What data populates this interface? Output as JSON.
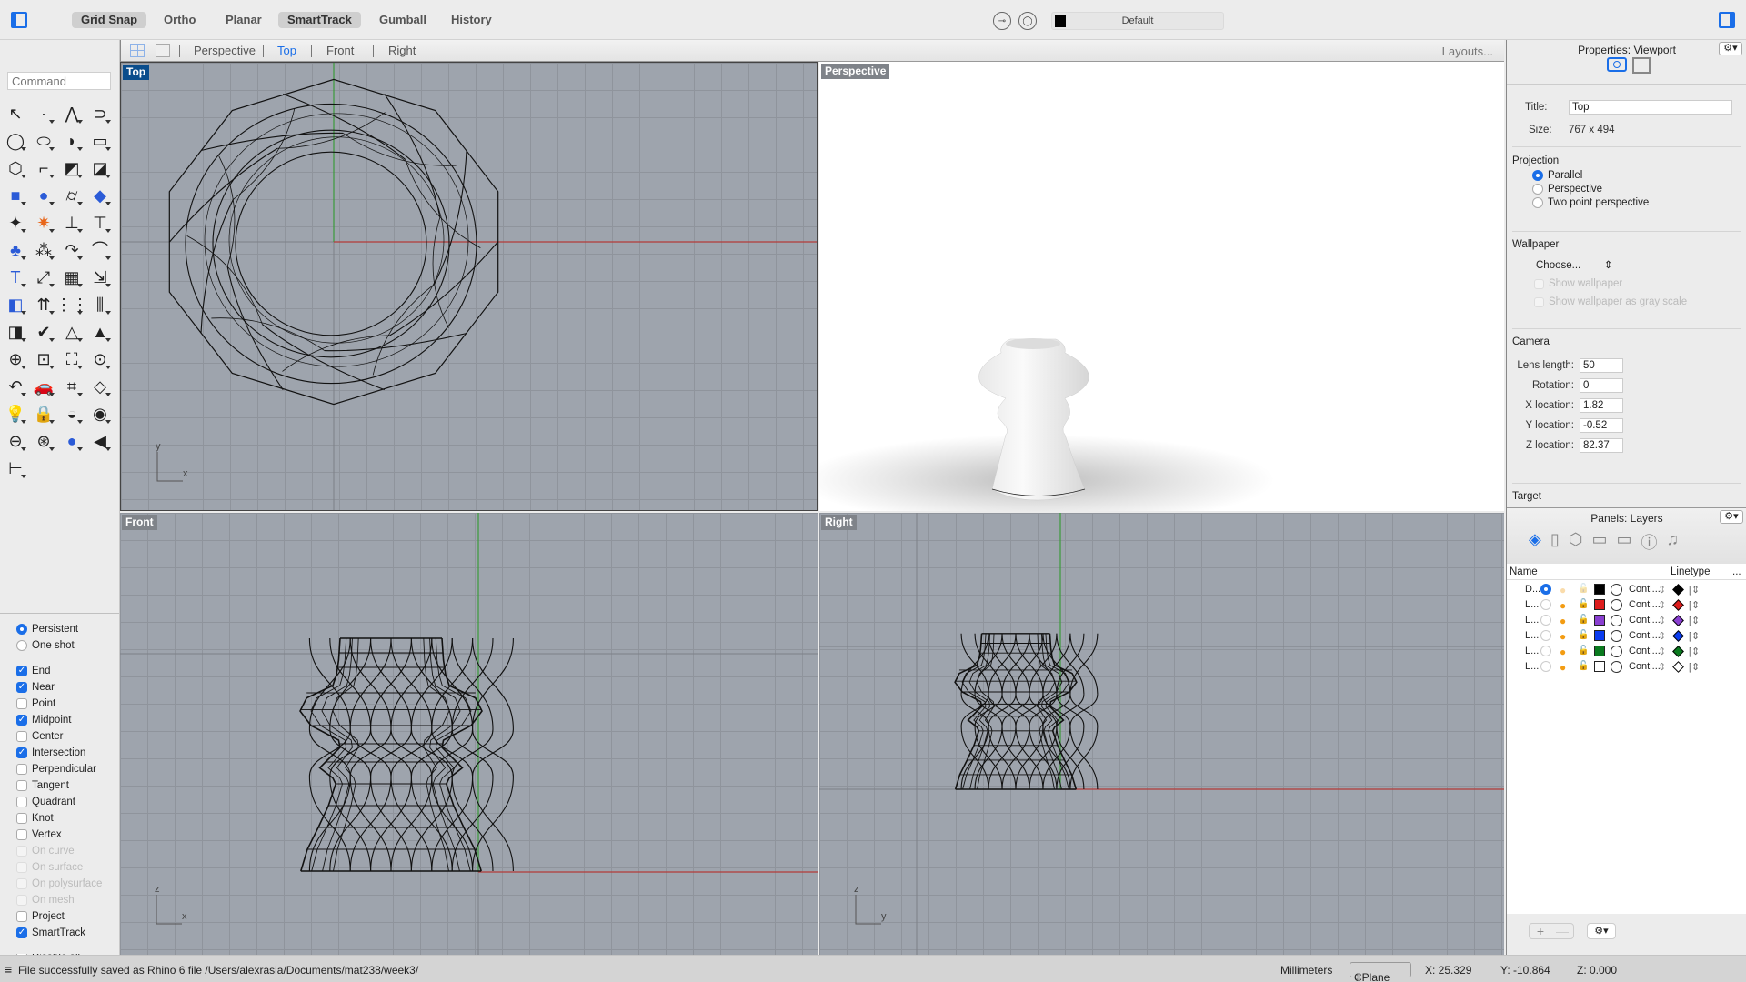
{
  "toolbar": {
    "modes": [
      {
        "label": "Grid Snap",
        "active": true
      },
      {
        "label": "Ortho",
        "active": false
      },
      {
        "label": "Planar",
        "active": false
      },
      {
        "label": "SmartTrack",
        "active": true
      },
      {
        "label": "Gumball",
        "active": false
      },
      {
        "label": "History",
        "active": false
      }
    ],
    "current_layer": "Default",
    "current_layer_color": "#000000"
  },
  "viewport_tabs": {
    "tabs": [
      "Perspective",
      "Top",
      "Front",
      "Right"
    ],
    "active": "Top",
    "layouts_label": "Layouts..."
  },
  "command": {
    "placeholder": "Command"
  },
  "tools": [
    {
      "icon": "select-arrow-icon",
      "glyph": "↖"
    },
    {
      "icon": "point-icon",
      "glyph": "·"
    },
    {
      "icon": "polyline-icon",
      "glyph": "⋀"
    },
    {
      "icon": "curve-icon",
      "glyph": "⊃"
    },
    {
      "icon": "circle-icon",
      "glyph": "◯"
    },
    {
      "icon": "ellipse-icon",
      "glyph": "⬭"
    },
    {
      "icon": "arc-icon",
      "glyph": "◗"
    },
    {
      "icon": "rectangle-icon",
      "glyph": "▭"
    },
    {
      "icon": "polygon-icon",
      "glyph": "⬡"
    },
    {
      "icon": "fillet-curve-icon",
      "glyph": "⌐"
    },
    {
      "icon": "surface-corner-icon",
      "glyph": "◩"
    },
    {
      "icon": "extrude-surface-icon",
      "glyph": "◪"
    },
    {
      "icon": "box-icon",
      "glyph": "■"
    },
    {
      "icon": "boolean-union-icon",
      "glyph": "●"
    },
    {
      "icon": "cylinder-icon",
      "glyph": "⌭"
    },
    {
      "icon": "surface-patch-icon",
      "glyph": "◆"
    },
    {
      "icon": "puzzle-join-icon",
      "glyph": "✦"
    },
    {
      "icon": "explode-icon",
      "glyph": "✷"
    },
    {
      "icon": "trim-icon",
      "glyph": "⊥"
    },
    {
      "icon": "split-icon",
      "glyph": "⊤"
    },
    {
      "icon": "boolean-difference-icon",
      "glyph": "♣"
    },
    {
      "icon": "points-group-icon",
      "glyph": "⁂"
    },
    {
      "icon": "rebuild-curve-icon",
      "glyph": "↷"
    },
    {
      "icon": "offset-curve-icon",
      "glyph": "⌒"
    },
    {
      "icon": "text-icon",
      "glyph": "T"
    },
    {
      "icon": "move-icon",
      "glyph": "⤢"
    },
    {
      "icon": "array-icon",
      "glyph": "▦"
    },
    {
      "icon": "scale-icon",
      "glyph": "⇲"
    },
    {
      "icon": "solid-edit-icon",
      "glyph": "◧"
    },
    {
      "icon": "normals-icon",
      "glyph": "⇈"
    },
    {
      "icon": "grid-array-icon",
      "glyph": "⋮⋮"
    },
    {
      "icon": "gumball-align-icon",
      "glyph": "⫼"
    },
    {
      "icon": "analyze-icon",
      "glyph": "◨"
    },
    {
      "icon": "check-icon",
      "glyph": "✔"
    },
    {
      "icon": "shapes-icon",
      "glyph": "△"
    },
    {
      "icon": "pyramid-icon",
      "glyph": "▲"
    },
    {
      "icon": "zoom-icon",
      "glyph": "⊕"
    },
    {
      "icon": "zoom-window-icon",
      "glyph": "⊡"
    },
    {
      "icon": "zoom-extents-icon",
      "glyph": "⛶"
    },
    {
      "icon": "zoom-selected-icon",
      "glyph": "⊙"
    },
    {
      "icon": "undo-view-icon",
      "glyph": "↶"
    },
    {
      "icon": "car-icon",
      "glyph": "🚗"
    },
    {
      "icon": "cplane-icon",
      "glyph": "⌗"
    },
    {
      "icon": "named-shapes-icon",
      "glyph": "◇"
    },
    {
      "icon": "light-bulb-icon",
      "glyph": "💡"
    },
    {
      "icon": "lock-icon",
      "glyph": "🔒"
    },
    {
      "icon": "materials-icon",
      "glyph": "◒"
    },
    {
      "icon": "color-wheel-icon",
      "glyph": "◉"
    },
    {
      "icon": "wireframe-sphere-icon",
      "glyph": "⊖"
    },
    {
      "icon": "grid-sphere-icon",
      "glyph": "⊛"
    },
    {
      "icon": "rendered-sphere-icon",
      "glyph": "●"
    },
    {
      "icon": "render-cone-icon",
      "glyph": "◀"
    },
    {
      "icon": "dimension-icon",
      "glyph": "⊢"
    }
  ],
  "osnap": {
    "mode": [
      {
        "label": "Persistent",
        "selected": true
      },
      {
        "label": "One shot",
        "selected": false
      }
    ],
    "items": [
      {
        "label": "End",
        "checked": true,
        "enabled": true
      },
      {
        "label": "Near",
        "checked": true,
        "enabled": true
      },
      {
        "label": "Point",
        "checked": false,
        "enabled": true
      },
      {
        "label": "Midpoint",
        "checked": true,
        "enabled": true
      },
      {
        "label": "Center",
        "checked": false,
        "enabled": true
      },
      {
        "label": "Intersection",
        "checked": true,
        "enabled": true
      },
      {
        "label": "Perpendicular",
        "checked": false,
        "enabled": true
      },
      {
        "label": "Tangent",
        "checked": false,
        "enabled": true
      },
      {
        "label": "Quadrant",
        "checked": false,
        "enabled": true
      },
      {
        "label": "Knot",
        "checked": false,
        "enabled": true
      },
      {
        "label": "Vertex",
        "checked": false,
        "enabled": true
      },
      {
        "label": "On curve",
        "checked": false,
        "enabled": false
      },
      {
        "label": "On surface",
        "checked": false,
        "enabled": false
      },
      {
        "label": "On polysurface",
        "checked": false,
        "enabled": false
      },
      {
        "label": "On mesh",
        "checked": false,
        "enabled": false
      },
      {
        "label": "Project",
        "checked": false,
        "enabled": true
      },
      {
        "label": "SmartTrack",
        "checked": true,
        "enabled": true
      }
    ],
    "partial_label": "Disable all"
  },
  "viewports": {
    "top": {
      "label": "Top",
      "axis": [
        "y",
        "x"
      ]
    },
    "perspective": {
      "label": "Perspective"
    },
    "front": {
      "label": "Front",
      "axis": [
        "z",
        "x"
      ]
    },
    "right": {
      "label": "Right",
      "axis": [
        "z",
        "y"
      ]
    }
  },
  "properties": {
    "header": "Properties: Viewport",
    "title_label": "Title:",
    "title_value": "Top",
    "size_label": "Size:",
    "size_value": "767 x 494",
    "projection": {
      "title": "Projection",
      "options": [
        {
          "label": "Parallel",
          "selected": true
        },
        {
          "label": "Perspective",
          "selected": false
        },
        {
          "label": "Two point perspective",
          "selected": false
        }
      ]
    },
    "wallpaper": {
      "title": "Wallpaper",
      "choose_label": "Choose...",
      "show_label": "Show wallpaper",
      "gray_label": "Show wallpaper as gray scale"
    },
    "camera": {
      "title": "Camera",
      "fields": [
        {
          "label": "Lens length:",
          "value": "50"
        },
        {
          "label": "Rotation:",
          "value": "0"
        },
        {
          "label": "X location:",
          "value": "1.82"
        },
        {
          "label": "Y location:",
          "value": "-0.52"
        },
        {
          "label": "Z location:",
          "value": "82.37"
        }
      ]
    },
    "target_title": "Target"
  },
  "layers": {
    "header": "Panels: Layers",
    "columns": {
      "name": "Name",
      "linetype": "Linetype",
      "more": "..."
    },
    "rows": [
      {
        "name": "D...",
        "current": true,
        "on": false,
        "color": "#000000",
        "linetype": "Conti...",
        "print_color": "#000000"
      },
      {
        "name": "L...",
        "current": false,
        "on": true,
        "color": "#dd1c1c",
        "linetype": "Conti...",
        "print_color": "#dd1c1c"
      },
      {
        "name": "L...",
        "current": false,
        "on": true,
        "color": "#8a3fd1",
        "linetype": "Conti...",
        "print_color": "#8a3fd1"
      },
      {
        "name": "L...",
        "current": false,
        "on": true,
        "color": "#0a3cf0",
        "linetype": "Conti...",
        "print_color": "#0a3cf0"
      },
      {
        "name": "L...",
        "current": false,
        "on": true,
        "color": "#0a7a1e",
        "linetype": "Conti...",
        "print_color": "#0a7a1e"
      },
      {
        "name": "L...",
        "current": false,
        "on": true,
        "color": "#ffffff",
        "linetype": "Conti...",
        "print_color": "#ffffff"
      }
    ],
    "add_label": "+",
    "remove_label": "—"
  },
  "status": {
    "message": "File successfully saved as Rhino 6 file /Users/alexrasla/Documents/mat238/week3/",
    "units": "Millimeters",
    "cplane": "CPlane",
    "x": "X: 25.329",
    "y": "Y: -10.864",
    "z": "Z: 0.000"
  }
}
